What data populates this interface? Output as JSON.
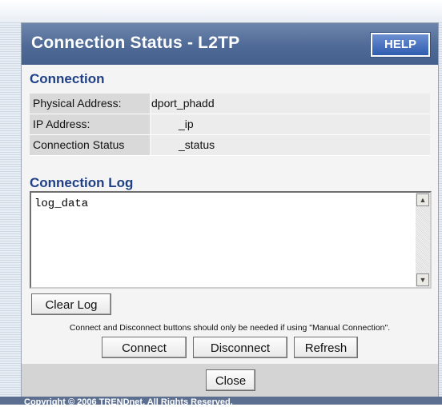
{
  "header": {
    "title": "Connection Status - L2TP",
    "help_label": "HELP"
  },
  "connection": {
    "section_title": "Connection",
    "rows": [
      {
        "label": "Physical Address:",
        "value": "dport_phadd"
      },
      {
        "label": "IP Address:",
        "value": "_ip"
      },
      {
        "label": "Connection Status",
        "value": "_status"
      }
    ]
  },
  "log": {
    "section_title": "Connection Log",
    "content": "log_data",
    "clear_label": "Clear Log"
  },
  "actions": {
    "note": "Connect and Disconnect buttons should only be needed if using \"Manual Connection\".",
    "connect_label": "Connect",
    "disconnect_label": "Disconnect",
    "refresh_label": "Refresh"
  },
  "footer": {
    "close_label": "Close",
    "copyright": "Copyright © 2006 TRENDnet. All Rights Reserved."
  }
}
